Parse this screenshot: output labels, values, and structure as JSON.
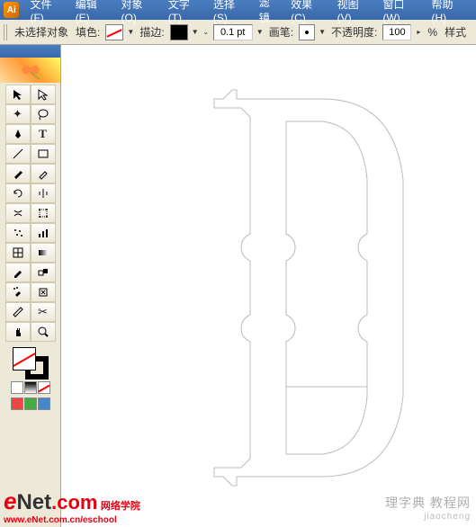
{
  "menu": {
    "file": "文件(F)",
    "edit": "编辑(E)",
    "object": "对象(O)",
    "type": "文字(T)",
    "select": "选择(S)",
    "filter": "滤镜",
    "effect": "效果(C)",
    "view": "视图(V)",
    "window": "窗口(W)",
    "help": "帮助(H)"
  },
  "optbar": {
    "noselection": "未选择对象",
    "fill_label": "填色:",
    "stroke_label": "描边:",
    "stroke_weight": "0.1 pt",
    "brush_label": "画笔:",
    "opacity_label": "不透明度:",
    "opacity_value": "100",
    "pct": "%",
    "style_label": "样式"
  },
  "watermark": {
    "left_brand1": "e",
    "left_brand2": "Net",
    "left_brand3": ".com",
    "left_text1": "网络学院",
    "left_url": "www.eNet.com.cn/eschool",
    "right_main": "理字典 教程网",
    "right_sub": "jiaocheng"
  }
}
